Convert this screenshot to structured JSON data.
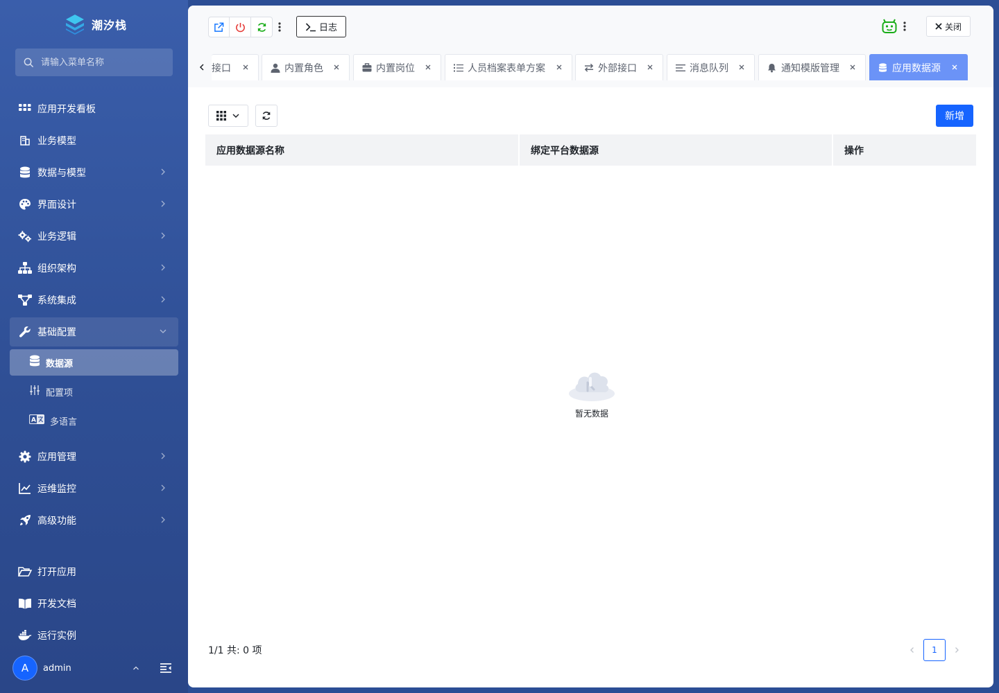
{
  "brand": {
    "name": "潮汐栈"
  },
  "menu_search": {
    "placeholder": "请输入菜单名称"
  },
  "nav": {
    "items": [
      {
        "label": "应用开发看板",
        "icon": "grid-icon"
      },
      {
        "label": "业务模型",
        "icon": "building-icon"
      },
      {
        "label": "数据与模型",
        "icon": "database-icon"
      },
      {
        "label": "界面设计",
        "icon": "palette-icon"
      },
      {
        "label": "业务逻辑",
        "icon": "gears-icon"
      },
      {
        "label": "组织架构",
        "icon": "org-chart-icon"
      },
      {
        "label": "系统集成",
        "icon": "integration-icon"
      },
      {
        "label": "基础配置",
        "icon": "wrench-icon"
      }
    ],
    "sub_items": [
      {
        "label": "数据源",
        "icon": "database-icon",
        "active": true
      },
      {
        "label": "配置项",
        "icon": "sliders-icon"
      },
      {
        "label": "多语言",
        "icon": "language-icon"
      }
    ],
    "items_after": [
      {
        "label": "应用管理",
        "icon": "gear-icon"
      },
      {
        "label": "运维监控",
        "icon": "chart-line-icon"
      },
      {
        "label": "高级功能",
        "icon": "rocket-icon"
      }
    ],
    "bottom_items": [
      {
        "label": "打开应用",
        "icon": "folder-open-icon"
      },
      {
        "label": "开发文档",
        "icon": "book-icon"
      },
      {
        "label": "运行实例",
        "icon": "docker-icon"
      }
    ]
  },
  "user": {
    "avatar_letter": "A",
    "name": "admin"
  },
  "toolbar": {
    "log_label": "日志",
    "close_label": "关闭"
  },
  "tabs": [
    {
      "label": "接口",
      "icon": ""
    },
    {
      "label": "内置角色",
      "icon": "user-tie-icon"
    },
    {
      "label": "内置岗位",
      "icon": "briefcase-icon"
    },
    {
      "label": "人员档案表单方案",
      "icon": "list-icon"
    },
    {
      "label": "外部接口",
      "icon": "exchange-icon"
    },
    {
      "label": "消息队列",
      "icon": "align-left-icon"
    },
    {
      "label": "通知模版管理",
      "icon": "bell-icon"
    },
    {
      "label": "应用数据源",
      "icon": "database-icon",
      "active": true
    }
  ],
  "page": {
    "add_label": "新增",
    "columns": [
      "应用数据源名称",
      "绑定平台数据源",
      "操作"
    ],
    "empty_text": "暂无数据",
    "summary": "1/1 共: 0 项",
    "current_page": "1"
  },
  "colors": {
    "primary": "#1664ff",
    "active_tab": "#6b93f7",
    "sidebar": "#3a5eab",
    "open_button": "#1677ff",
    "power_button": "#e53935",
    "refresh_button": "#1aad19"
  }
}
